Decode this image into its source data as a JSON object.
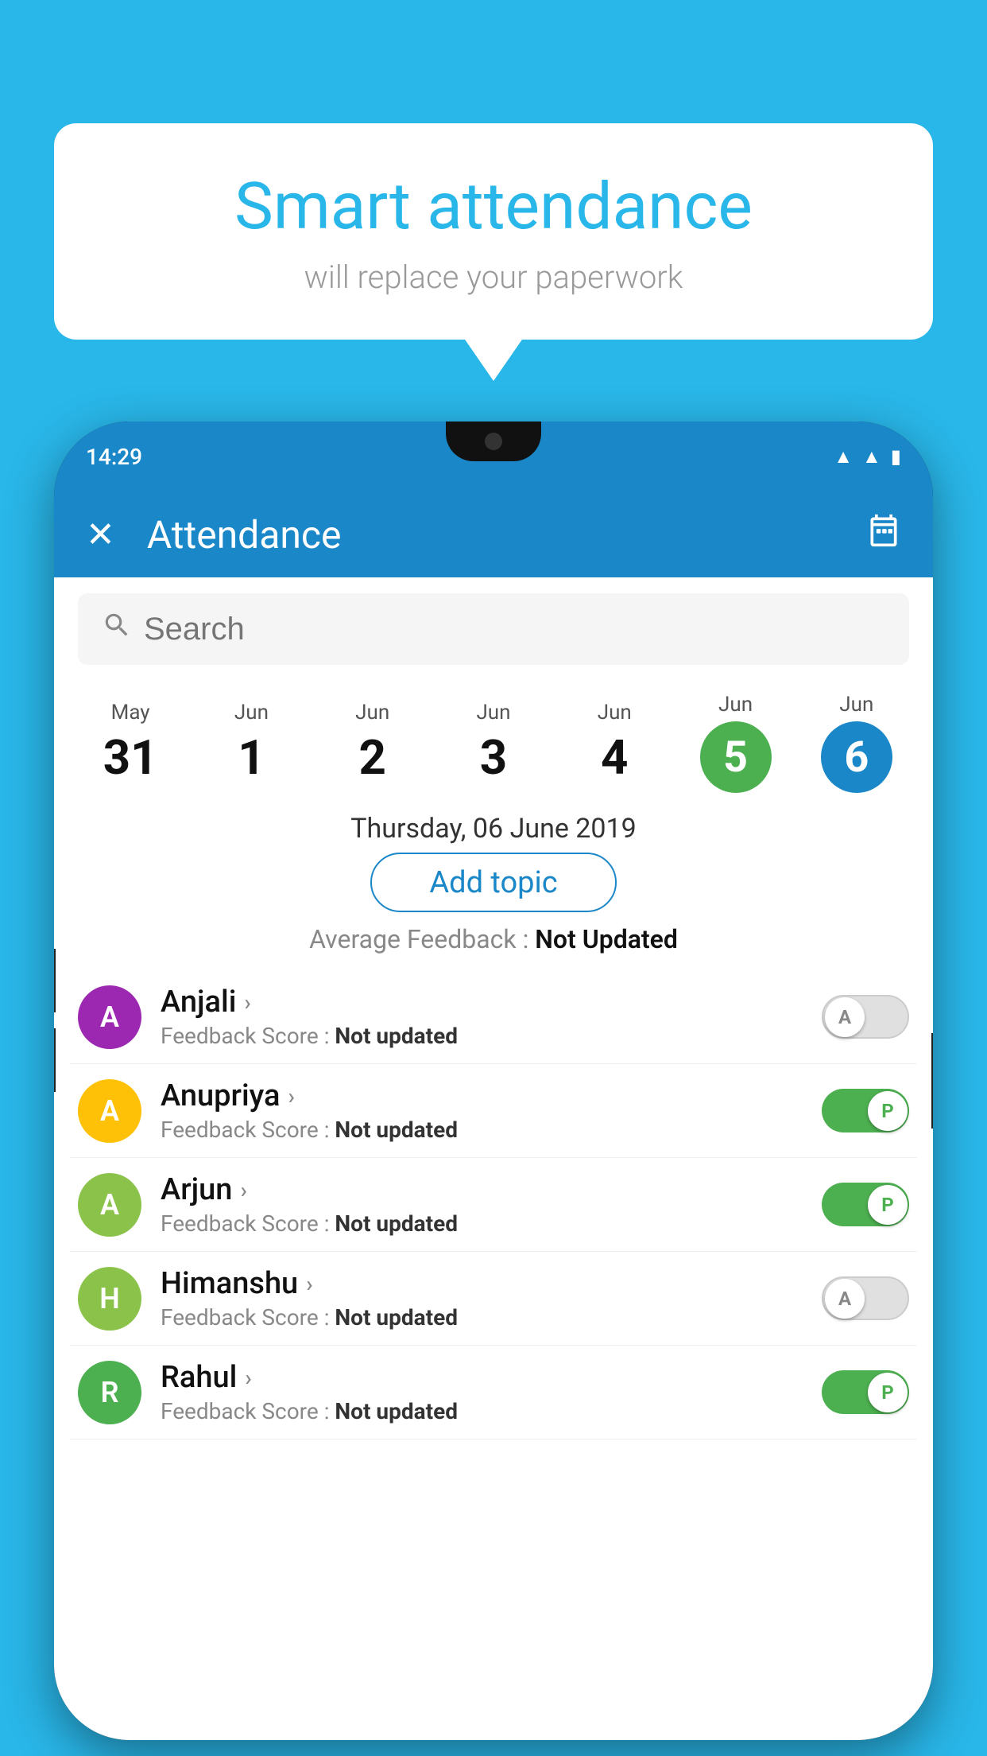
{
  "background_color": "#29B6E8",
  "bubble": {
    "title": "Smart attendance",
    "subtitle": "will replace your paperwork"
  },
  "phone": {
    "status_bar": {
      "time": "14:29"
    },
    "app_header": {
      "title": "Attendance",
      "close_icon": "✕",
      "calendar_icon": "📅"
    },
    "search": {
      "placeholder": "Search"
    },
    "dates": [
      {
        "month": "May",
        "day": "31",
        "type": "normal"
      },
      {
        "month": "Jun",
        "day": "1",
        "type": "normal"
      },
      {
        "month": "Jun",
        "day": "2",
        "type": "normal"
      },
      {
        "month": "Jun",
        "day": "3",
        "type": "normal"
      },
      {
        "month": "Jun",
        "day": "4",
        "type": "normal"
      },
      {
        "month": "Jun",
        "day": "5",
        "type": "today"
      },
      {
        "month": "Jun",
        "day": "6",
        "type": "selected"
      }
    ],
    "selected_date_label": "Thursday, 06 June 2019",
    "add_topic_label": "Add topic",
    "avg_feedback_label": "Average Feedback :",
    "avg_feedback_value": "Not Updated",
    "students": [
      {
        "name": "Anjali",
        "initial": "A",
        "avatar_color": "#9C27B0",
        "feedback_label": "Feedback Score :",
        "feedback_value": "Not updated",
        "toggle_state": "off",
        "toggle_label": "A"
      },
      {
        "name": "Anupriya",
        "initial": "A",
        "avatar_color": "#FFC107",
        "feedback_label": "Feedback Score :",
        "feedback_value": "Not updated",
        "toggle_state": "on",
        "toggle_label": "P"
      },
      {
        "name": "Arjun",
        "initial": "A",
        "avatar_color": "#8BC34A",
        "feedback_label": "Feedback Score :",
        "feedback_value": "Not updated",
        "toggle_state": "on",
        "toggle_label": "P"
      },
      {
        "name": "Himanshu",
        "initial": "H",
        "avatar_color": "#8BC34A",
        "feedback_label": "Feedback Score :",
        "feedback_value": "Not updated",
        "toggle_state": "off",
        "toggle_label": "A"
      },
      {
        "name": "Rahul",
        "initial": "R",
        "avatar_color": "#4CAF50",
        "feedback_label": "Feedback Score :",
        "feedback_value": "Not updated",
        "toggle_state": "on",
        "toggle_label": "P"
      }
    ]
  }
}
